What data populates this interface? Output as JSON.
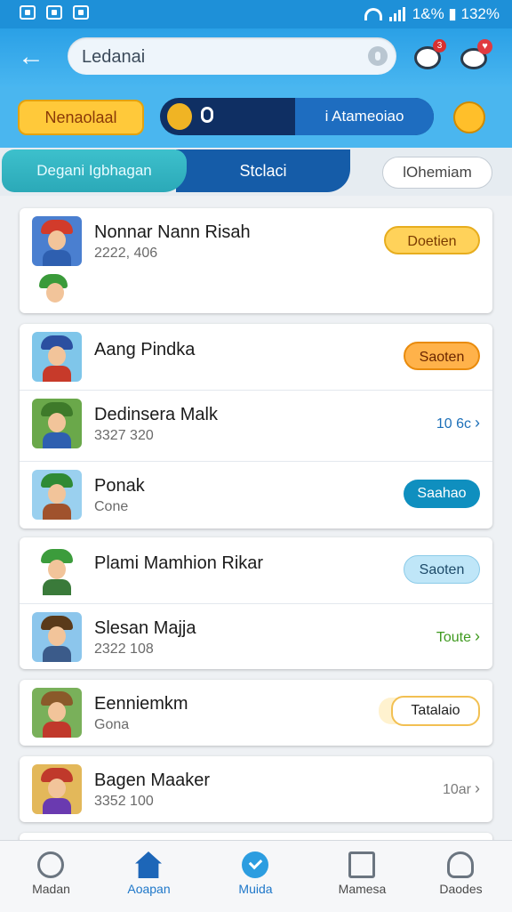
{
  "status_bar": {
    "text": "1&% ▮ 132%"
  },
  "toolbar": {
    "search_value": "Ledanai"
  },
  "action_row": {
    "yellow_button": "Nenaolaal",
    "segment_right": "i Atameoiao"
  },
  "tabs": {
    "active": "Degani Igbhagan",
    "middle": "Stclaci",
    "right": "lOhemiam"
  },
  "cards": [
    {
      "rows": [
        {
          "name": "Nonnar Nann Risah",
          "sub": "2222, 406",
          "action": "Doetien"
        }
      ]
    },
    {
      "rows": [
        {
          "name": "Aang Pindka",
          "sub": "",
          "action": "Saoten"
        },
        {
          "name": "Dedinsera Malk",
          "sub": "3327 320",
          "action": "10 6c"
        },
        {
          "name": "Ponak",
          "sub": "Cone",
          "action": "Saahao"
        }
      ]
    },
    {
      "rows": [
        {
          "name": "Plami Mamhion Rikar",
          "sub": "",
          "action": "Saoten"
        },
        {
          "name": "Slesan Majja",
          "sub": "2322 108",
          "action": "Toute"
        }
      ]
    },
    {
      "rows": [
        {
          "name": "Eenniemkm",
          "sub": "Gona",
          "action": "Tatalaio"
        }
      ]
    },
    {
      "rows": [
        {
          "name": "Bagen Maaker",
          "sub": "3352 100",
          "action": "10ar"
        }
      ]
    }
  ],
  "bottom_nav": [
    {
      "label": "Madan"
    },
    {
      "label": "Aoapan"
    },
    {
      "label": "Muida"
    },
    {
      "label": "Mamesa"
    },
    {
      "label": "Daodes"
    }
  ],
  "colors": {
    "accent": "#2aa0e6",
    "nav_active": "#1e77c9"
  },
  "icons": [
    "back-arrow-icon",
    "search-icon",
    "notification-icon",
    "gift-icon",
    "trophy-icon",
    "home-icon",
    "check-icon",
    "calendar-icon",
    "user-icon"
  ]
}
